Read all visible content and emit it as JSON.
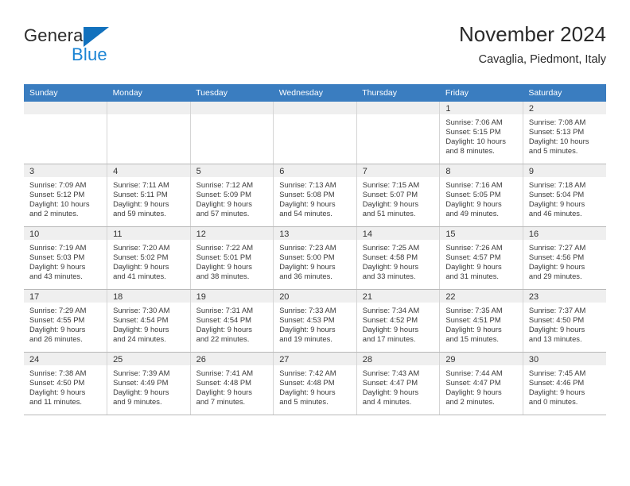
{
  "brand": {
    "word1": "General",
    "word2": "Blue",
    "logo_icon": "blue-triangle-icon",
    "accent_color": "#1b84d4",
    "triangle_color": "#1271bd"
  },
  "header": {
    "title": "November 2024",
    "subtitle": "Cavaglia, Piedmont, Italy"
  },
  "theme": {
    "header_row_bg": "#3a7dc0",
    "daynum_band_bg": "#efefef",
    "grid_line": "#b9b9b9"
  },
  "weekday_headers": [
    "Sunday",
    "Monday",
    "Tuesday",
    "Wednesday",
    "Thursday",
    "Friday",
    "Saturday"
  ],
  "weeks": [
    [
      {
        "day": "",
        "lines": []
      },
      {
        "day": "",
        "lines": []
      },
      {
        "day": "",
        "lines": []
      },
      {
        "day": "",
        "lines": []
      },
      {
        "day": "",
        "lines": []
      },
      {
        "day": "1",
        "lines": [
          "Sunrise: 7:06 AM",
          "Sunset: 5:15 PM",
          "Daylight: 10 hours",
          "and 8 minutes."
        ]
      },
      {
        "day": "2",
        "lines": [
          "Sunrise: 7:08 AM",
          "Sunset: 5:13 PM",
          "Daylight: 10 hours",
          "and 5 minutes."
        ]
      }
    ],
    [
      {
        "day": "3",
        "lines": [
          "Sunrise: 7:09 AM",
          "Sunset: 5:12 PM",
          "Daylight: 10 hours",
          "and 2 minutes."
        ]
      },
      {
        "day": "4",
        "lines": [
          "Sunrise: 7:11 AM",
          "Sunset: 5:11 PM",
          "Daylight: 9 hours",
          "and 59 minutes."
        ]
      },
      {
        "day": "5",
        "lines": [
          "Sunrise: 7:12 AM",
          "Sunset: 5:09 PM",
          "Daylight: 9 hours",
          "and 57 minutes."
        ]
      },
      {
        "day": "6",
        "lines": [
          "Sunrise: 7:13 AM",
          "Sunset: 5:08 PM",
          "Daylight: 9 hours",
          "and 54 minutes."
        ]
      },
      {
        "day": "7",
        "lines": [
          "Sunrise: 7:15 AM",
          "Sunset: 5:07 PM",
          "Daylight: 9 hours",
          "and 51 minutes."
        ]
      },
      {
        "day": "8",
        "lines": [
          "Sunrise: 7:16 AM",
          "Sunset: 5:05 PM",
          "Daylight: 9 hours",
          "and 49 minutes."
        ]
      },
      {
        "day": "9",
        "lines": [
          "Sunrise: 7:18 AM",
          "Sunset: 5:04 PM",
          "Daylight: 9 hours",
          "and 46 minutes."
        ]
      }
    ],
    [
      {
        "day": "10",
        "lines": [
          "Sunrise: 7:19 AM",
          "Sunset: 5:03 PM",
          "Daylight: 9 hours",
          "and 43 minutes."
        ]
      },
      {
        "day": "11",
        "lines": [
          "Sunrise: 7:20 AM",
          "Sunset: 5:02 PM",
          "Daylight: 9 hours",
          "and 41 minutes."
        ]
      },
      {
        "day": "12",
        "lines": [
          "Sunrise: 7:22 AM",
          "Sunset: 5:01 PM",
          "Daylight: 9 hours",
          "and 38 minutes."
        ]
      },
      {
        "day": "13",
        "lines": [
          "Sunrise: 7:23 AM",
          "Sunset: 5:00 PM",
          "Daylight: 9 hours",
          "and 36 minutes."
        ]
      },
      {
        "day": "14",
        "lines": [
          "Sunrise: 7:25 AM",
          "Sunset: 4:58 PM",
          "Daylight: 9 hours",
          "and 33 minutes."
        ]
      },
      {
        "day": "15",
        "lines": [
          "Sunrise: 7:26 AM",
          "Sunset: 4:57 PM",
          "Daylight: 9 hours",
          "and 31 minutes."
        ]
      },
      {
        "day": "16",
        "lines": [
          "Sunrise: 7:27 AM",
          "Sunset: 4:56 PM",
          "Daylight: 9 hours",
          "and 29 minutes."
        ]
      }
    ],
    [
      {
        "day": "17",
        "lines": [
          "Sunrise: 7:29 AM",
          "Sunset: 4:55 PM",
          "Daylight: 9 hours",
          "and 26 minutes."
        ]
      },
      {
        "day": "18",
        "lines": [
          "Sunrise: 7:30 AM",
          "Sunset: 4:54 PM",
          "Daylight: 9 hours",
          "and 24 minutes."
        ]
      },
      {
        "day": "19",
        "lines": [
          "Sunrise: 7:31 AM",
          "Sunset: 4:54 PM",
          "Daylight: 9 hours",
          "and 22 minutes."
        ]
      },
      {
        "day": "20",
        "lines": [
          "Sunrise: 7:33 AM",
          "Sunset: 4:53 PM",
          "Daylight: 9 hours",
          "and 19 minutes."
        ]
      },
      {
        "day": "21",
        "lines": [
          "Sunrise: 7:34 AM",
          "Sunset: 4:52 PM",
          "Daylight: 9 hours",
          "and 17 minutes."
        ]
      },
      {
        "day": "22",
        "lines": [
          "Sunrise: 7:35 AM",
          "Sunset: 4:51 PM",
          "Daylight: 9 hours",
          "and 15 minutes."
        ]
      },
      {
        "day": "23",
        "lines": [
          "Sunrise: 7:37 AM",
          "Sunset: 4:50 PM",
          "Daylight: 9 hours",
          "and 13 minutes."
        ]
      }
    ],
    [
      {
        "day": "24",
        "lines": [
          "Sunrise: 7:38 AM",
          "Sunset: 4:50 PM",
          "Daylight: 9 hours",
          "and 11 minutes."
        ]
      },
      {
        "day": "25",
        "lines": [
          "Sunrise: 7:39 AM",
          "Sunset: 4:49 PM",
          "Daylight: 9 hours",
          "and 9 minutes."
        ]
      },
      {
        "day": "26",
        "lines": [
          "Sunrise: 7:41 AM",
          "Sunset: 4:48 PM",
          "Daylight: 9 hours",
          "and 7 minutes."
        ]
      },
      {
        "day": "27",
        "lines": [
          "Sunrise: 7:42 AM",
          "Sunset: 4:48 PM",
          "Daylight: 9 hours",
          "and 5 minutes."
        ]
      },
      {
        "day": "28",
        "lines": [
          "Sunrise: 7:43 AM",
          "Sunset: 4:47 PM",
          "Daylight: 9 hours",
          "and 4 minutes."
        ]
      },
      {
        "day": "29",
        "lines": [
          "Sunrise: 7:44 AM",
          "Sunset: 4:47 PM",
          "Daylight: 9 hours",
          "and 2 minutes."
        ]
      },
      {
        "day": "30",
        "lines": [
          "Sunrise: 7:45 AM",
          "Sunset: 4:46 PM",
          "Daylight: 9 hours",
          "and 0 minutes."
        ]
      }
    ]
  ]
}
